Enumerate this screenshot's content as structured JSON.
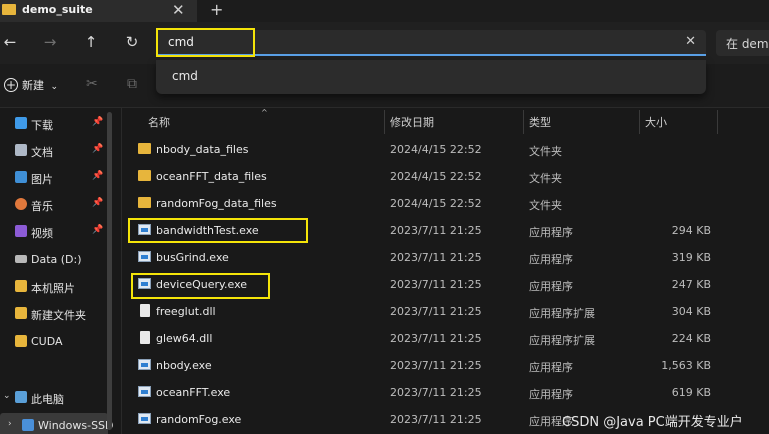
{
  "tab": {
    "title": "demo_suite",
    "close": "✕",
    "new": "+"
  },
  "nav": {
    "back": "←",
    "forward": "→",
    "up": "↑",
    "refresh": "↻"
  },
  "address": {
    "value": "cmd",
    "clear": "✕"
  },
  "search": {
    "placeholder": "在 demo"
  },
  "suggestion": {
    "label": "cmd"
  },
  "command_bar": {
    "new_label": "新建",
    "new_plus": "+",
    "chevron": "⌄",
    "cut_icon": "✂",
    "copy_icon": "⧉"
  },
  "sidebar": {
    "items": [
      {
        "label": "下载",
        "icon": "download-icon",
        "color": "#3f9ae8",
        "pinned": true,
        "pin": "📌"
      },
      {
        "label": "文档",
        "icon": "document-icon",
        "color": "#aeb8c6",
        "pinned": true,
        "pin": "📌"
      },
      {
        "label": "图片",
        "icon": "pictures-icon",
        "color": "#3f8fd6",
        "pinned": true,
        "pin": "📌"
      },
      {
        "label": "音乐",
        "icon": "music-icon",
        "color": "#e0783c",
        "pinned": true,
        "pin": "📌"
      },
      {
        "label": "视频",
        "icon": "video-icon",
        "color": "#8c5bd6",
        "pinned": true,
        "pin": "📌"
      },
      {
        "label": "Data (D:)",
        "icon": "drive-icon",
        "color": "#b8b8b8",
        "pinned": false,
        "pin": ""
      },
      {
        "label": "本机照片",
        "icon": "folder-icon",
        "color": "#e7b53c",
        "pinned": false,
        "pin": ""
      },
      {
        "label": "新建文件夹",
        "icon": "folder-icon",
        "color": "#e7b53c",
        "pinned": false,
        "pin": ""
      },
      {
        "label": "CUDA",
        "icon": "folder-icon",
        "color": "#e7b53c",
        "pinned": false,
        "pin": ""
      }
    ],
    "this_pc": {
      "label": "此电脑",
      "chevron": "⌄"
    },
    "windows_drive": {
      "label": "Windows-SSD",
      "chevron": "›"
    }
  },
  "columns": {
    "name": "名称",
    "date": "修改日期",
    "type": "类型",
    "size": "大小",
    "sort": "^"
  },
  "files": [
    {
      "name": "nbody_data_files",
      "date": "2024/4/15 22:52",
      "type": "文件夹",
      "size": "",
      "icon": "folder"
    },
    {
      "name": "oceanFFT_data_files",
      "date": "2024/4/15 22:52",
      "type": "文件夹",
      "size": "",
      "icon": "folder"
    },
    {
      "name": "randomFog_data_files",
      "date": "2024/4/15 22:52",
      "type": "文件夹",
      "size": "",
      "icon": "folder"
    },
    {
      "name": "bandwidthTest.exe",
      "date": "2023/7/11 21:25",
      "type": "应用程序",
      "size": "294 KB",
      "icon": "exe"
    },
    {
      "name": "busGrind.exe",
      "date": "2023/7/11 21:25",
      "type": "应用程序",
      "size": "319 KB",
      "icon": "exe"
    },
    {
      "name": "deviceQuery.exe",
      "date": "2023/7/11 21:25",
      "type": "应用程序",
      "size": "247 KB",
      "icon": "exe"
    },
    {
      "name": "freeglut.dll",
      "date": "2023/7/11 21:25",
      "type": "应用程序扩展",
      "size": "304 KB",
      "icon": "dll"
    },
    {
      "name": "glew64.dll",
      "date": "2023/7/11 21:25",
      "type": "应用程序扩展",
      "size": "224 KB",
      "icon": "dll"
    },
    {
      "name": "nbody.exe",
      "date": "2023/7/11 21:25",
      "type": "应用程序",
      "size": "1,563 KB",
      "icon": "exe"
    },
    {
      "name": "oceanFFT.exe",
      "date": "2023/7/11 21:25",
      "type": "应用程序",
      "size": "619 KB",
      "icon": "exe"
    },
    {
      "name": "randomFog.exe",
      "date": "2023/7/11 21:25",
      "type": "应用程序",
      "size": "",
      "icon": "exe"
    }
  ],
  "watermark": "CSDN @Java PC端开发专业户",
  "colors": {
    "highlight": "#f4e409",
    "accent": "#5aa0e6",
    "background": "#191919"
  }
}
